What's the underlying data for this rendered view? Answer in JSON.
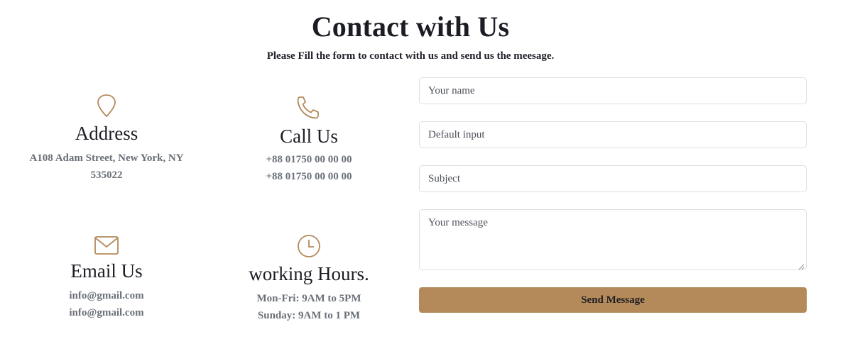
{
  "header": {
    "title": "Contact with Us",
    "subtitle": "Please Fill the form to contact with us and send us the meesage."
  },
  "address": {
    "icon": "map-pin-icon",
    "heading": "Address",
    "lines": [
      "A108 Adam Street, New York, NY",
      "535022"
    ]
  },
  "call": {
    "icon": "phone-icon",
    "heading": "Call Us",
    "lines": [
      "+88 01750 00 00 00",
      "+88 01750 00 00 00"
    ]
  },
  "email": {
    "icon": "envelope-icon",
    "heading": "Email Us",
    "lines": [
      "info@gmail.com",
      "info@gmail.com"
    ]
  },
  "hours": {
    "icon": "clock-icon",
    "heading": "working Hours.",
    "lines": [
      "Mon-Fri: 9AM to 5PM",
      "Sunday: 9AM to 1 PM"
    ]
  },
  "form": {
    "name_placeholder": "Your name",
    "default_placeholder": "Default input",
    "subject_placeholder": "Subject",
    "message_placeholder": "Your message",
    "submit_label": "Send Message"
  },
  "colors": {
    "accent": "#b48a5b",
    "heading": "#1c1d24",
    "muted_text": "#6b7078",
    "field_border": "#dcdfe3"
  }
}
